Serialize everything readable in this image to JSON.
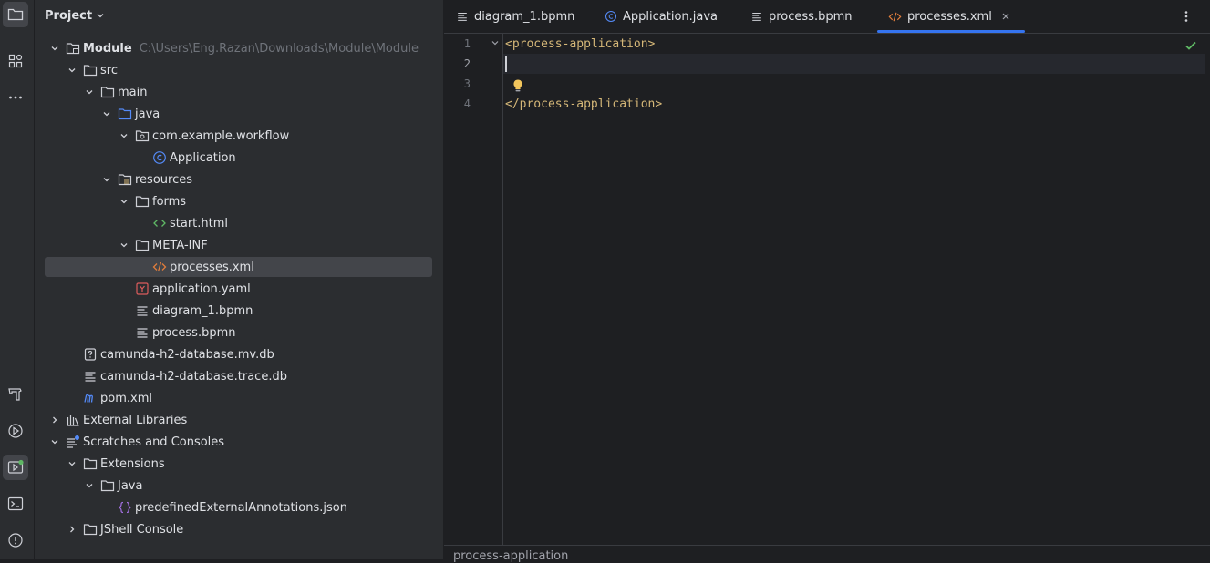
{
  "toolstrip": {
    "top": [
      "folder-icon",
      "structure-icon",
      "more-icon"
    ],
    "bottom": [
      "build-icon",
      "services-icon",
      "run-icon",
      "terminal-icon",
      "problems-icon"
    ]
  },
  "project_panel": {
    "title": "Project",
    "tree": [
      {
        "label": "Module",
        "path": "C:\\Users\\Eng.Razan\\Downloads\\Module\\Module",
        "bold": true
      },
      {
        "label": "src"
      },
      {
        "label": "main"
      },
      {
        "label": "java"
      },
      {
        "label": "com.example.workflow"
      },
      {
        "label": "Application"
      },
      {
        "label": "resources"
      },
      {
        "label": "forms"
      },
      {
        "label": "start.html"
      },
      {
        "label": "META-INF"
      },
      {
        "label": "processes.xml",
        "selected": true
      },
      {
        "label": "application.yaml"
      },
      {
        "label": "diagram_1.bpmn"
      },
      {
        "label": "process.bpmn"
      },
      {
        "label": "camunda-h2-database.mv.db"
      },
      {
        "label": "camunda-h2-database.trace.db"
      },
      {
        "label": "pom.xml"
      },
      {
        "label": "External Libraries"
      },
      {
        "label": "Scratches and Consoles"
      },
      {
        "label": "Extensions"
      },
      {
        "label": "Java"
      },
      {
        "label": "predefinedExternalAnnotations.json"
      },
      {
        "label": "JShell Console"
      }
    ]
  },
  "tabs": [
    {
      "label": "diagram_1.bpmn",
      "active": false
    },
    {
      "label": "Application.java",
      "active": false
    },
    {
      "label": "process.bpmn",
      "active": false
    },
    {
      "label": "processes.xml",
      "active": true
    }
  ],
  "editor": {
    "lines": [
      {
        "num": "1",
        "text": "<process-application>"
      },
      {
        "num": "2",
        "text": ""
      },
      {
        "num": "3",
        "text": ""
      },
      {
        "num": "4",
        "text": "</process-application>"
      }
    ],
    "current_line": 2
  },
  "breadcrumb": "process-application",
  "colors": {
    "accent": "#3574f0",
    "xml_tag": "#d5b778",
    "check": "#5fb865"
  }
}
